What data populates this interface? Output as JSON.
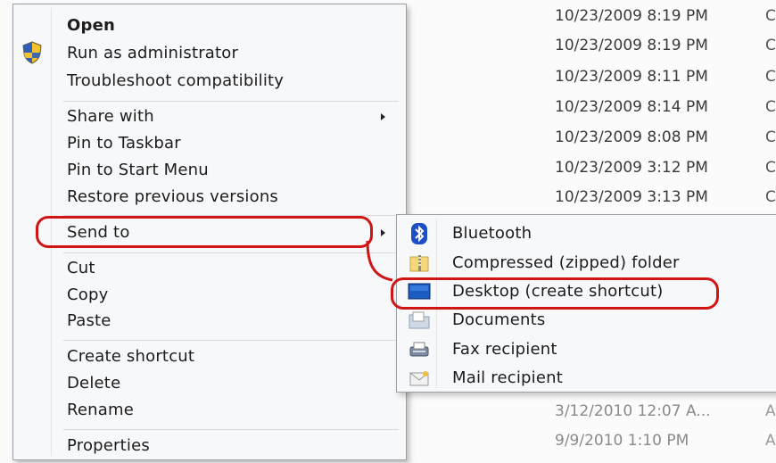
{
  "file_list": {
    "dates": [
      "10/23/2009 8:19 PM",
      "10/23/2009 8:19 PM",
      "10/23/2009 8:11 PM",
      "10/23/2009 8:14 PM",
      "10/23/2009 8:08 PM",
      "10/23/2009 3:12 PM",
      "10/23/2009 3:13 PM",
      "3/12/2010 12:07 A...",
      "9/9/2010 1:10 PM"
    ],
    "trailing_chars": [
      "C",
      "C",
      "C",
      "C",
      "C",
      "C",
      "C",
      "A",
      "A"
    ]
  },
  "context_menu": {
    "open": "Open",
    "run_as_admin": "Run as administrator",
    "troubleshoot": "Troubleshoot compatibility",
    "share_with": "Share with",
    "pin_taskbar": "Pin to Taskbar",
    "pin_start": "Pin to Start Menu",
    "restore_versions": "Restore previous versions",
    "send_to": "Send to",
    "cut": "Cut",
    "copy": "Copy",
    "paste": "Paste",
    "create_shortcut": "Create shortcut",
    "delete": "Delete",
    "rename": "Rename",
    "properties": "Properties"
  },
  "send_to_menu": {
    "bluetooth": "Bluetooth",
    "compressed": "Compressed (zipped) folder",
    "desktop": "Desktop (create shortcut)",
    "documents": "Documents",
    "fax": "Fax recipient",
    "mail": "Mail recipient"
  },
  "icons": {
    "shield": "uac-shield-icon",
    "bluetooth": "bluetooth-icon",
    "zip": "zip-folder-icon",
    "desktop": "desktop-icon",
    "documents": "documents-icon",
    "fax": "fax-icon",
    "mail": "mail-icon"
  },
  "colors": {
    "highlight": "#d01515",
    "menu_bg": "#f7f8fa"
  }
}
